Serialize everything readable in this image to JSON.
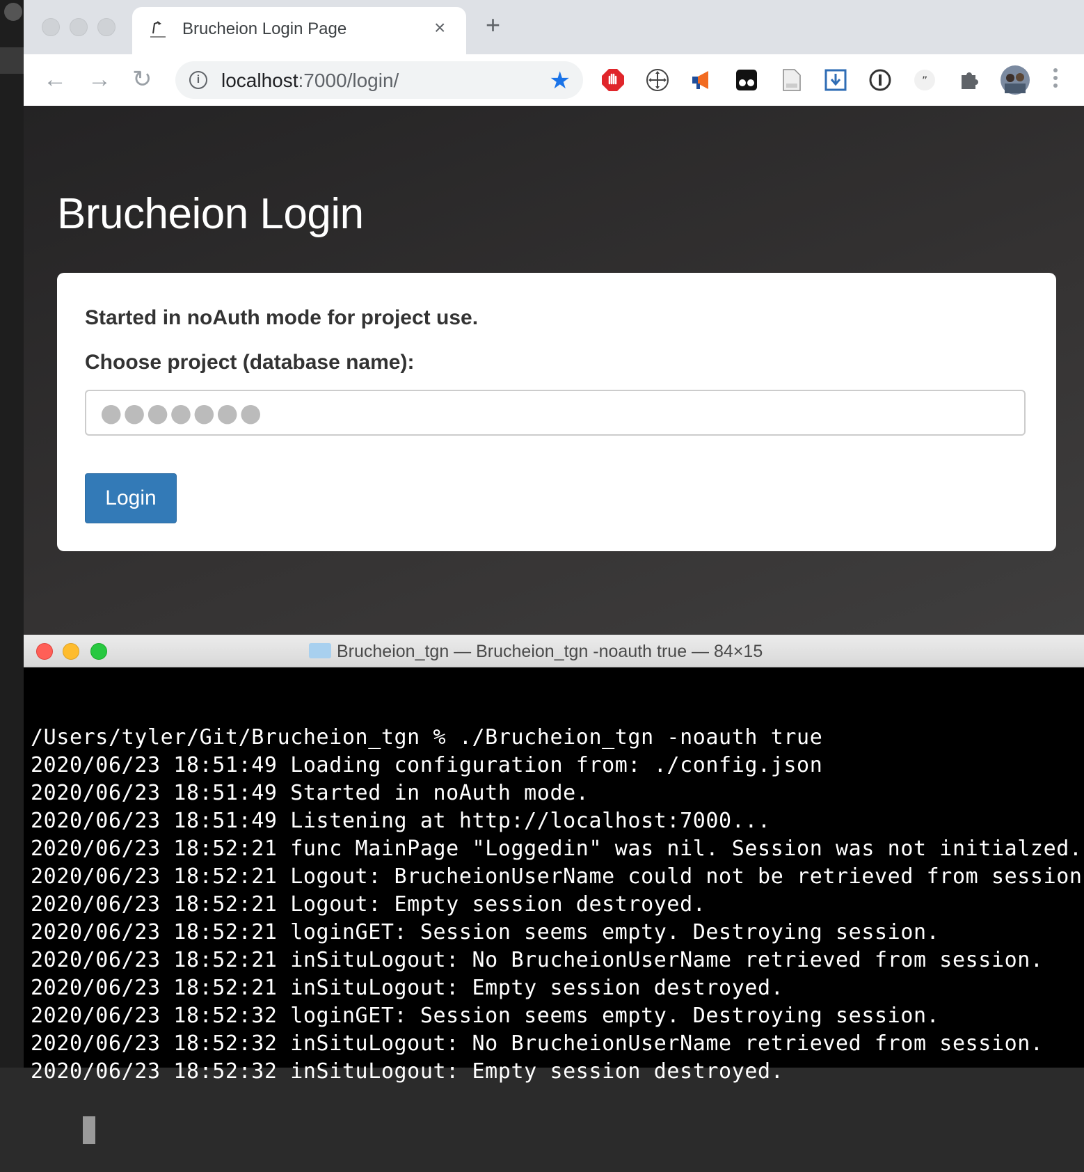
{
  "browser": {
    "tab": {
      "title": "Brucheion Login Page",
      "close": "×"
    },
    "new_tab": "+",
    "nav": {
      "back": "←",
      "forward": "→",
      "reload": "↻"
    },
    "omnibox": {
      "info": "i",
      "host": "localhost",
      "path": ":7000/login/",
      "bookmark_star": "★"
    },
    "extensions": [
      "stop-hand-icon",
      "move-icon",
      "megaphone-icon",
      "glasses-icon",
      "document-icon",
      "download-icon",
      "password-icon",
      "quote-icon",
      "puzzle-icon",
      "profile-avatar"
    ]
  },
  "page": {
    "heading": "Brucheion Login",
    "notice": "Started in noAuth mode for project use.",
    "project_label": "Choose project (database name):",
    "project_value": "●●●●●●●",
    "login_button": "Login"
  },
  "terminal": {
    "title": "Brucheion_tgn — Brucheion_tgn -noauth true — 84×15",
    "lines": [
      "/Users/tyler/Git/Brucheion_tgn % ./Brucheion_tgn -noauth true",
      "2020/06/23 18:51:49 Loading configuration from: ./config.json",
      "2020/06/23 18:51:49 Started in noAuth mode.",
      "2020/06/23 18:51:49 Listening at http://localhost:7000...",
      "2020/06/23 18:52:21 func MainPage \"Loggedin\" was nil. Session was not initialzed.",
      "2020/06/23 18:52:21 Logout: BrucheionUserName could not be retrieved from session.",
      "2020/06/23 18:52:21 Logout: Empty session destroyed.",
      "2020/06/23 18:52:21 loginGET: Session seems empty. Destroying session.",
      "2020/06/23 18:52:21 inSituLogout: No BrucheionUserName retrieved from session.",
      "2020/06/23 18:52:21 inSituLogout: Empty session destroyed.",
      "2020/06/23 18:52:32 loginGET: Session seems empty. Destroying session.",
      "2020/06/23 18:52:32 inSituLogout: No BrucheionUserName retrieved from session.",
      "2020/06/23 18:52:32 inSituLogout: Empty session destroyed."
    ]
  },
  "colors": {
    "login_button": "#337ab7",
    "bookmark_star": "#1a73e8",
    "terminal_bg": "#000000",
    "close_light": "#ff5f57",
    "minimize_light": "#febc2e",
    "zoom_light": "#28c840"
  }
}
